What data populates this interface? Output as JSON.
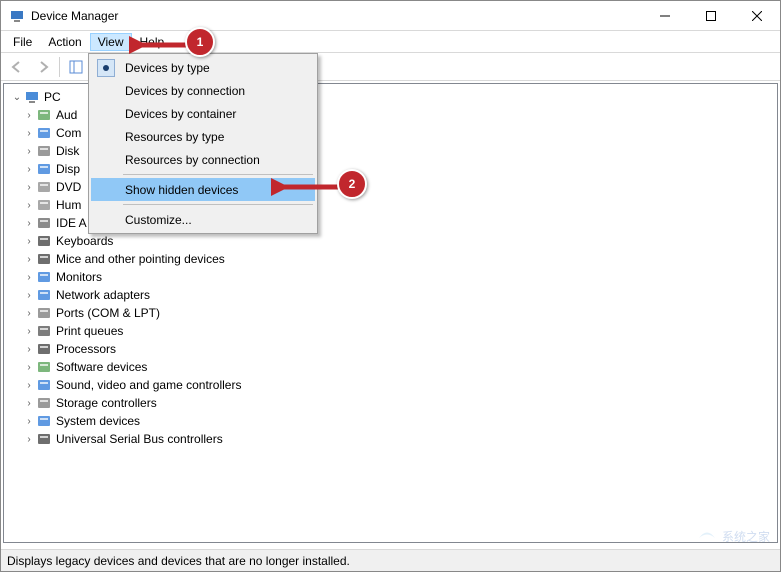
{
  "window": {
    "title": "Device Manager"
  },
  "menubar": {
    "file": "File",
    "action": "Action",
    "view": "View",
    "help": "Help"
  },
  "dropdown": {
    "dev_type": "Devices by type",
    "dev_conn": "Devices by connection",
    "dev_cont": "Devices by container",
    "res_type": "Resources by type",
    "res_conn": "Resources by connection",
    "show_hidden": "Show hidden devices",
    "customize": "Customize..."
  },
  "tree": {
    "root": "PC",
    "items": [
      "Aud",
      "Com",
      "Disk",
      "Disp",
      "DVD",
      "Hum",
      "IDE A",
      "Keyboards",
      "Mice and other pointing devices",
      "Monitors",
      "Network adapters",
      "Ports (COM & LPT)",
      "Print queues",
      "Processors",
      "Software devices",
      "Sound, video and game controllers",
      "Storage controllers",
      "System devices",
      "Universal Serial Bus controllers"
    ]
  },
  "statusbar": {
    "text": "Displays legacy devices and devices that are no longer installed."
  },
  "annotations": {
    "one": "1",
    "two": "2"
  },
  "icons": {
    "audio": "🔊",
    "computer": "🖥",
    "disk": "💽",
    "display": "🖥",
    "dvd": "💿",
    "hid": "🎛",
    "ide": "⚙",
    "keyboard": "⌨",
    "mouse": "🖱",
    "monitor": "🖥",
    "network": "📶",
    "port": "🔌",
    "printer": "🖨",
    "cpu": "▣",
    "software": "⚙",
    "sound": "🎵",
    "storage": "🗄",
    "system": "🖥",
    "usb": "🔌"
  }
}
